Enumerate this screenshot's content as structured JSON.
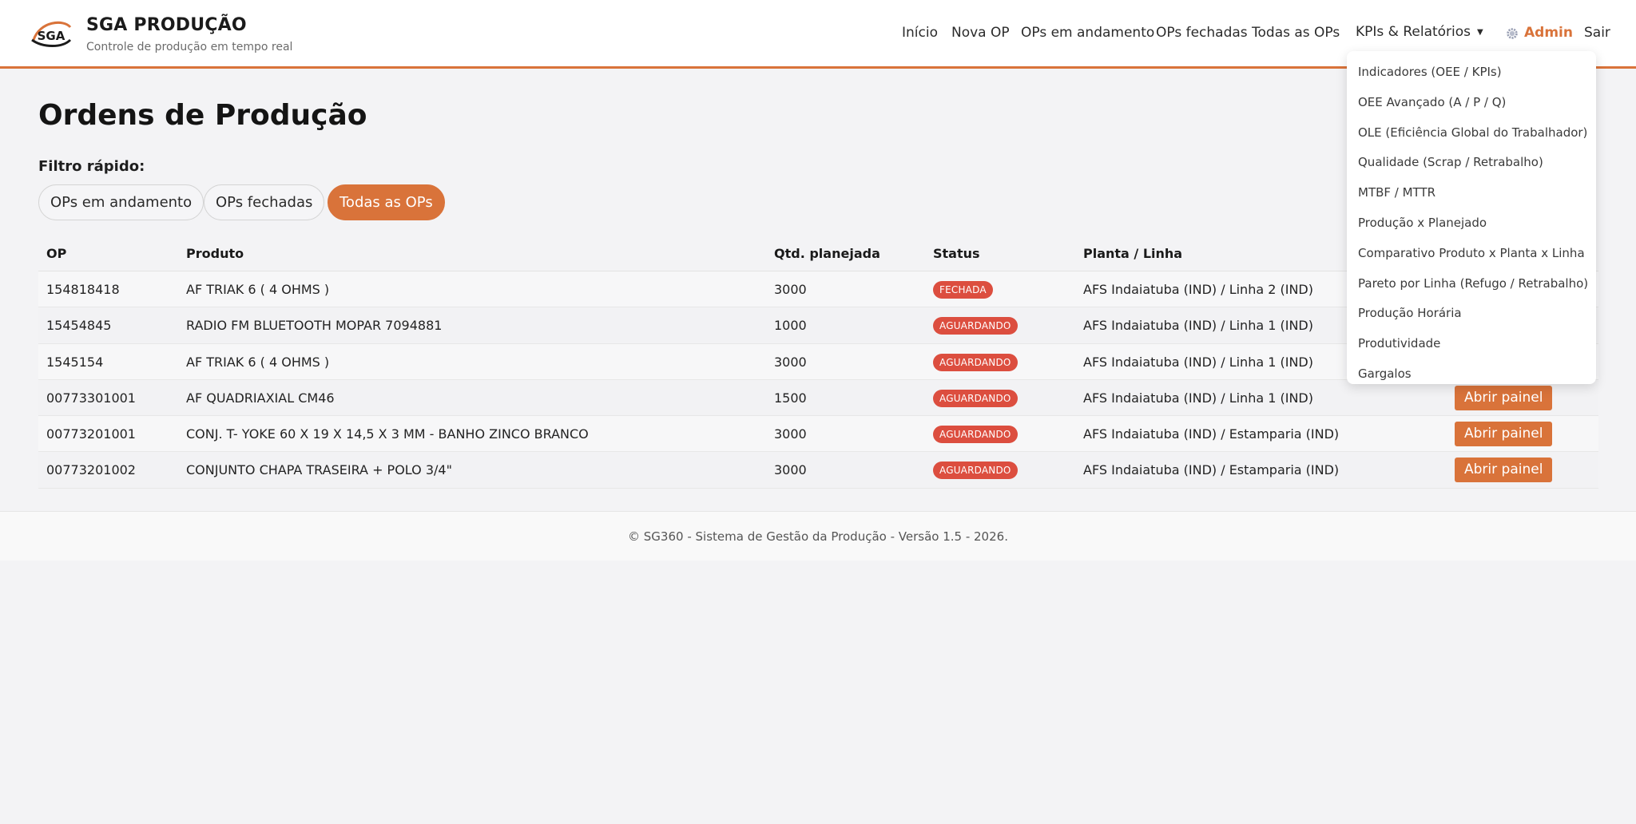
{
  "brand": {
    "title": "SGA PRODUÇÃO",
    "subtitle": "Controle de produção em tempo real",
    "logo_text": "SGA"
  },
  "nav": {
    "items": [
      "Início",
      "Nova OP",
      "OPs em andamento",
      "OPs fechadas",
      "Todas as OPs"
    ],
    "kpis_label": "KPIs & Relatórios",
    "admin_label": "Admin",
    "logout_label": "Sair"
  },
  "dropdown": {
    "items": [
      "Indicadores (OEE / KPIs)",
      "OEE Avançado (A / P / Q)",
      "OLE (Eficiência Global do Trabalhador)",
      "Qualidade (Scrap / Retrabalho)",
      "MTBF / MTTR",
      "Produção x Planejado",
      "Comparativo Produto x Planta x Linha",
      "Pareto por Linha (Refugo / Retrabalho)",
      "Produção Horária",
      "Produtividade",
      "Gargalos"
    ]
  },
  "main": {
    "title": "Ordens de Produção",
    "filter_label": "Filtro rápido:",
    "filters": [
      "OPs em andamento",
      "OPs fechadas",
      "Todas as OPs"
    ],
    "active_filter": "Todas as OPs"
  },
  "table": {
    "headers": [
      "OP",
      "Produto",
      "Qtd. planejada",
      "Status",
      "Planta / Linha"
    ],
    "action_label": "Abrir painel",
    "rows": [
      {
        "op": "154818418",
        "produto": "AF TRIAK 6 ( 4 OHMS )",
        "qtd": "3000",
        "status": "FECHADA",
        "planta": "AFS Indaiatuba (IND) / Linha 2 (IND)"
      },
      {
        "op": "15454845",
        "produto": "RADIO FM BLUETOOTH MOPAR 7094881",
        "qtd": "1000",
        "status": "AGUARDANDO",
        "planta": "AFS Indaiatuba (IND) / Linha 1 (IND)"
      },
      {
        "op": "1545154",
        "produto": "AF TRIAK 6 ( 4 OHMS )",
        "qtd": "3000",
        "status": "AGUARDANDO",
        "planta": "AFS Indaiatuba (IND) / Linha 1 (IND)"
      },
      {
        "op": "00773301001",
        "produto": "AF QUADRIAXIAL CM46",
        "qtd": "1500",
        "status": "AGUARDANDO",
        "planta": "AFS Indaiatuba (IND) / Linha 1 (IND)"
      },
      {
        "op": "00773201001",
        "produto": "CONJ. T- YOKE 60 X 19 X 14,5 X 3 MM - BANHO ZINCO BRANCO",
        "qtd": "3000",
        "status": "AGUARDANDO",
        "planta": "AFS Indaiatuba (IND) / Estamparia (IND)"
      },
      {
        "op": "00773201002",
        "produto": "CONJUNTO CHAPA TRASEIRA + POLO 3/4\"",
        "qtd": "3000",
        "status": "AGUARDANDO",
        "planta": "AFS Indaiatuba (IND) / Estamparia (IND)"
      }
    ]
  },
  "footer": {
    "text": "© SG360 - Sistema de Gestão da Produção - Versão 1.5 - 2026."
  },
  "colors": {
    "accent": "#d9733a",
    "status_badge": "#dc4e3f"
  },
  "icons": {
    "admin": "gear-icon",
    "dropdown": "caret-down-icon"
  }
}
